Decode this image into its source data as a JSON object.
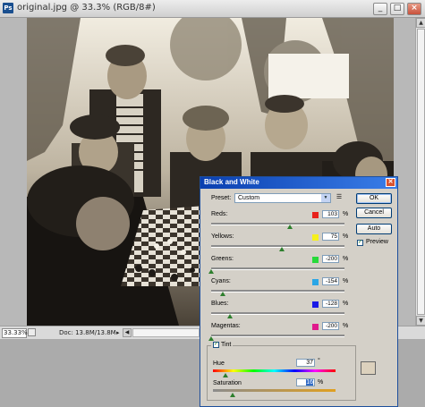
{
  "document": {
    "icon": "Ps",
    "title": "original.jpg @ 33.3% (RGB/8#)",
    "window_buttons": [
      "_",
      "□",
      "×"
    ]
  },
  "status": {
    "zoom": "33.33%",
    "doc_info": "Doc: 13.8M/13.8M"
  },
  "dialog": {
    "title": "Black and White",
    "preset_label": "Preset:",
    "preset_value": "Custom",
    "buttons": {
      "ok": "OK",
      "cancel": "Cancel",
      "auto": "Auto"
    },
    "preview_label": "Preview",
    "preview_checked": true,
    "sliders": [
      {
        "name": "Reds:",
        "value": "103",
        "unit": "%",
        "color": "#e8211b",
        "level": 0.59
      },
      {
        "name": "Yellows:",
        "value": "75",
        "unit": "%",
        "color": "#f6f01c",
        "level": 0.53
      },
      {
        "name": "Greens:",
        "value": "-200",
        "unit": "%",
        "color": "#27d93a",
        "level": 0.0
      },
      {
        "name": "Cyans:",
        "value": "-154",
        "unit": "%",
        "color": "#2ba6e6",
        "level": 0.09
      },
      {
        "name": "Blues:",
        "value": "-128",
        "unit": "%",
        "color": "#1a1ae6",
        "level": 0.14
      },
      {
        "name": "Magentas:",
        "value": "-200",
        "unit": "%",
        "color": "#e01a8c",
        "level": 0.0
      }
    ],
    "tint": {
      "label": "Tint",
      "checked": true,
      "hue_label": "Hue",
      "hue_value": "37",
      "hue_unit": "°",
      "hue_level": 0.1,
      "saturation_label": "Saturation",
      "saturation_value": "16",
      "saturation_unit": "%",
      "saturation_level": 0.16,
      "color": "#dcd1bd"
    }
  }
}
